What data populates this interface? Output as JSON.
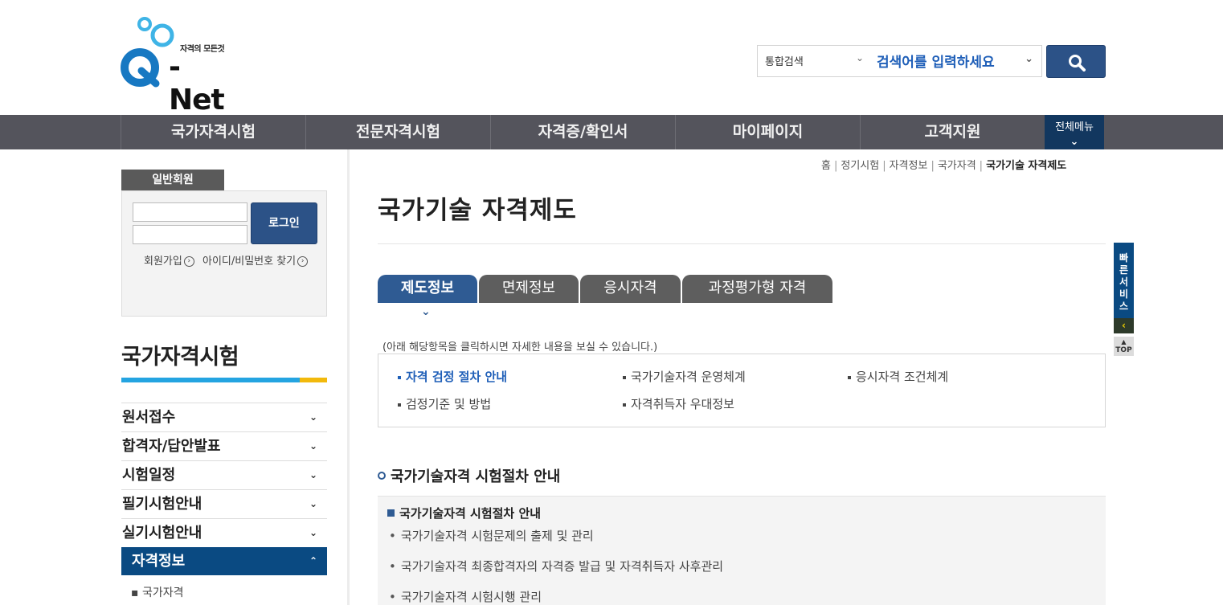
{
  "header": {
    "logo_small": "자격의 모든것",
    "logo_big": "-Net",
    "search_scope": "통합검색",
    "search_placeholder": "검색어를 입력하세요"
  },
  "gnb": {
    "items": [
      "국가자격시험",
      "전문자격시험",
      "자격증/확인서",
      "마이페이지",
      "고객지원"
    ],
    "all_menu": "전체메뉴"
  },
  "login": {
    "tab": "일반회원",
    "button": "로그인",
    "signup": "회원가입",
    "find": "아이디/비밀번호 찾기"
  },
  "sidebar": {
    "title": "국가자격시험",
    "items": [
      "원서접수",
      "합격자/답안발표",
      "시험일정",
      "필기시험안내",
      "실기시험안내",
      "자격정보"
    ],
    "active_index": 5,
    "sub_item": "국가자격"
  },
  "breadcrumb": [
    "홈",
    "정기시험",
    "자격정보",
    "국가자격",
    "국가기술 자격제도"
  ],
  "page_title": "국가기술 자격제도",
  "tabs": [
    "제도정보",
    "면제정보",
    "응시자격",
    "과정평가형 자격"
  ],
  "guide_text": "(아래 해당항목을 클릭하시면 자세한 내용을 보실 수 있습니다.)",
  "links": [
    "자격 검정 절차 안내",
    "국가기술자격 운영체계",
    "응시자격 조건체계",
    "검정기준 및 방법",
    "자격취득자 우대정보"
  ],
  "section": {
    "title": "국가기술자격 시험절차 안내",
    "panel_head": "국가기술자격 시험절차 안내",
    "items": [
      "국가기술자격 시험문제의 출제 및 관리",
      "국가기술자격 최종합격자의 자격증 발급 및 자격취득자 사후관리",
      "국가기술자격 시험시행 관리"
    ]
  },
  "quick": {
    "label": "빠른서비스",
    "top": "TOP"
  },
  "colors": {
    "gnb_bg": "#54545c",
    "primary": "#2c5287",
    "active_menu": "#0a4a82",
    "accent_blue": "#24a4e1",
    "accent_yellow": "#f2b90c"
  }
}
